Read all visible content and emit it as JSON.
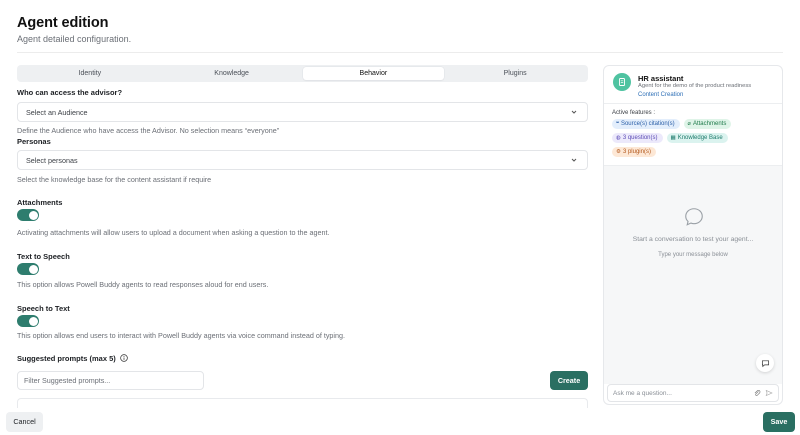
{
  "header": {
    "title": "Agent edition",
    "subtitle": "Agent detailed configuration."
  },
  "tabs": [
    {
      "label": "Identity",
      "active": false
    },
    {
      "label": "Knowledge",
      "active": false
    },
    {
      "label": "Behavior",
      "active": true
    },
    {
      "label": "Plugins",
      "active": false
    }
  ],
  "behavior": {
    "audience_label": "Who can access the advisor?",
    "audience_value": "Select an Audience",
    "audience_help": "Define the Audience who have access the Advisor. No selection means “everyone”",
    "personas_label": "Personas",
    "personas_value": "Select personas",
    "personas_help": "Select the knowledge base for the content assistant if require",
    "attachments_label": "Attachments",
    "attachments_help": "Activating attachments will allow users to upload a document when asking a question to the agent.",
    "tts_label": "Text to Speech",
    "tts_help": "This option allows Powell Buddy agents to read responses aloud for end users.",
    "stt_label": "Speech to Text",
    "stt_help": "This option allows end users to interact with Powell Buddy agents via voice command instead of typing.",
    "prompts_label": "Suggested prompts (max 5)",
    "prompts_placeholder": "Filter Suggested prompts...",
    "create_label": "Create"
  },
  "toggles": {
    "attachments": true,
    "tts": true,
    "stt": true
  },
  "agent": {
    "name": "HR assistant",
    "description": "Agent for the demo of the product readiness",
    "category": "Content Creation",
    "features_label": "Active features :",
    "features": [
      {
        "label": "Source(s) citation(s)",
        "icon": "quote-icon"
      },
      {
        "label": "Attachments",
        "icon": "paperclip-icon"
      },
      {
        "label": "3 question(s)",
        "icon": "question-icon"
      },
      {
        "label": "Knowledge Base",
        "icon": "database-icon"
      },
      {
        "label": "3 plugin(s)",
        "icon": "plugin-icon"
      }
    ]
  },
  "chat": {
    "empty_title": "Start a conversation to test your agent...",
    "empty_subtitle": "Type your message below",
    "input_placeholder": "Ask me a question..."
  },
  "footer": {
    "cancel_label": "Cancel",
    "save_label": "Save"
  },
  "colors": {
    "primary": "#2a6f62",
    "toggle_on": "#2e7d6e",
    "avatar": "#4fc3a1"
  }
}
